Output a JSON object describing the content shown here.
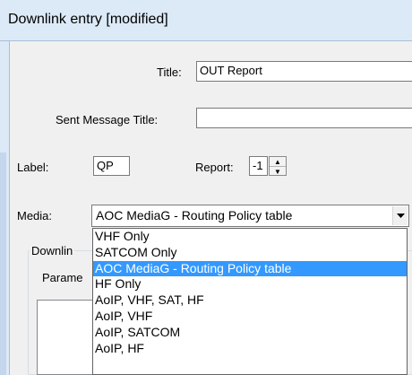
{
  "window": {
    "title": "Downlink entry [modified]"
  },
  "fields": {
    "title": {
      "label": "Title:",
      "value": "OUT Report"
    },
    "sent_message_title": {
      "label": "Sent Message Title:",
      "value": ""
    },
    "label": {
      "label": "Label:",
      "value": "QP"
    },
    "report": {
      "label": "Report:",
      "value": "-1"
    },
    "media": {
      "label": "Media:",
      "value": "AOC MediaG - Routing Policy table"
    }
  },
  "group": {
    "legend_visible": "Downlin",
    "param_visible": "Parame"
  },
  "dropdown": {
    "options": [
      "VHF Only",
      "SATCOM Only",
      "AOC MediaG - Routing Policy table",
      "HF Only",
      "AoIP, VHF, SAT, HF",
      "AoIP, VHF",
      "AoIP, SATCOM",
      "AoIP, HF"
    ],
    "selected_index": 2
  },
  "icons": {
    "spin_up": "spin-up-arrow-icon",
    "spin_down": "spin-down-arrow-icon",
    "combo_arrow": "chevron-down-icon"
  },
  "colors": {
    "selection": "#3399ff",
    "titlebar": "#dce9f7"
  }
}
